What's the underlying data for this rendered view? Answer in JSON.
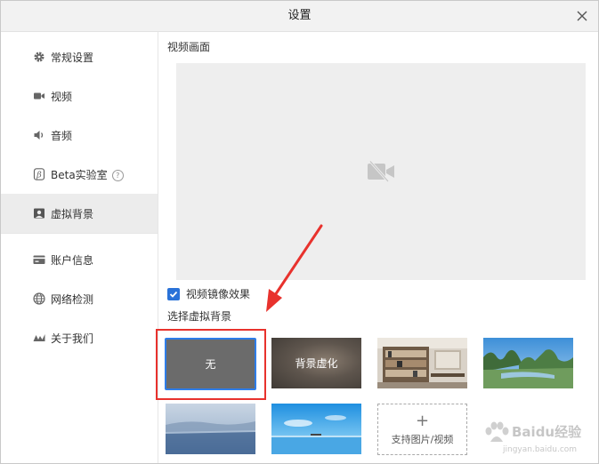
{
  "window": {
    "title": "设置"
  },
  "sidebar": {
    "items": [
      {
        "label": "常规设置",
        "icon": "gear-icon"
      },
      {
        "label": "视频",
        "icon": "video-camera-icon"
      },
      {
        "label": "音频",
        "icon": "speaker-icon"
      },
      {
        "label": "Beta实验室",
        "icon": "beta-icon",
        "help_icon": "help-circle-icon"
      },
      {
        "label": "虚拟背景",
        "icon": "portrait-icon",
        "active": true
      },
      {
        "label": "账户信息",
        "icon": "card-icon"
      },
      {
        "label": "网络检测",
        "icon": "globe-icon"
      },
      {
        "label": "关于我们",
        "icon": "logo-icon"
      }
    ]
  },
  "main": {
    "video_section_label": "视频画面",
    "preview_icon": "camera-off-icon",
    "mirror": {
      "label": "视频镜像效果",
      "checked": true
    },
    "bg_section_label": "选择虚拟背景",
    "backgrounds": {
      "none_label": "无",
      "blur_label": "背景虚化",
      "add_plus": "+",
      "add_label": "支持图片/视频"
    }
  },
  "watermark": {
    "line1": "Baidu经验",
    "line2": "jingyan.baidu.com"
  },
  "colors": {
    "accent": "#2e7de8",
    "highlight": "#e8322d",
    "active_item_bg": "#ececec"
  }
}
